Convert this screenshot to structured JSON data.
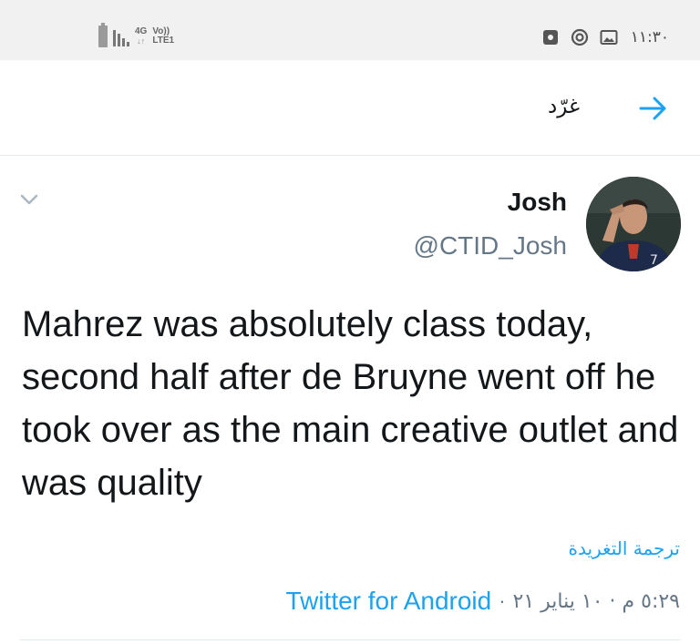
{
  "status_bar": {
    "network_type": "4G",
    "network_arrows": "↓↑",
    "volte_top": "Vo))",
    "volte_bottom": "LTE1",
    "time": "١١:٣٠",
    "icons": [
      "battery-icon",
      "signal-bars-icon",
      "app-notification-icon",
      "vpn-icon",
      "gallery-icon"
    ]
  },
  "header": {
    "title": "غرّد",
    "back_icon": "arrow-right-icon"
  },
  "tweet": {
    "author_name": "Josh",
    "author_handle": "@CTID_Josh",
    "text": "Mahrez was absolutely class today, second half after de Bruyne went off he took over as the main creative outlet and was quality",
    "translate_label": "ترجمة التغريدة",
    "timestamp": "٥:٢٩ م · ١٠ يناير ٢١",
    "separator": "·",
    "source": "Twitter for Android"
  },
  "colors": {
    "accent": "#1da1f2",
    "secondary_text": "#657786",
    "divider": "#e1e8ed",
    "status_bar_bg": "#f1f1f1"
  }
}
